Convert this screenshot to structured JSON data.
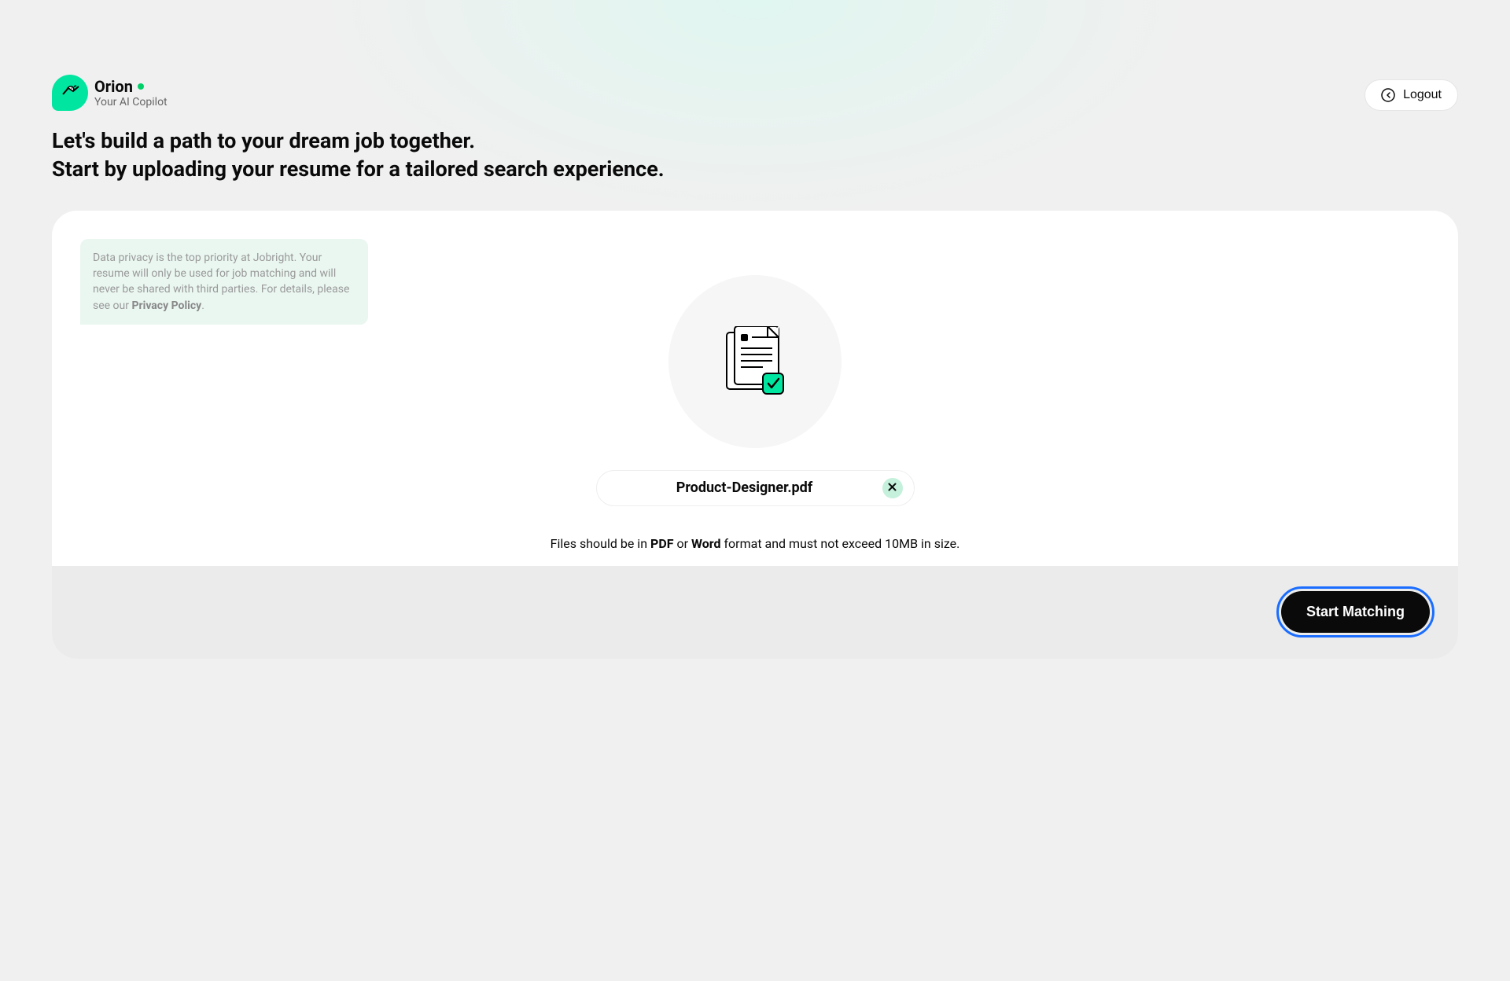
{
  "brand": {
    "name": "Orion",
    "subtitle": "Your AI Copilot"
  },
  "header": {
    "logout_label": "Logout"
  },
  "headline": {
    "line1": "Let's build a path to your dream job together.",
    "line2": "Start by uploading your resume for a tailored search experience."
  },
  "privacy": {
    "text_prefix": "Data privacy is the top priority at Jobright. Your resume will only be used for job matching and will never be shared with third parties. For details, please see our ",
    "link_text": "Privacy Policy",
    "text_suffix": "."
  },
  "upload": {
    "file_name": "Product-Designer.pdf",
    "hint_prefix": "Files should be in ",
    "hint_pdf": "PDF",
    "hint_or": " or ",
    "hint_word": "Word",
    "hint_suffix": " format and must not exceed 10MB in size."
  },
  "footer": {
    "start_label": "Start Matching"
  }
}
